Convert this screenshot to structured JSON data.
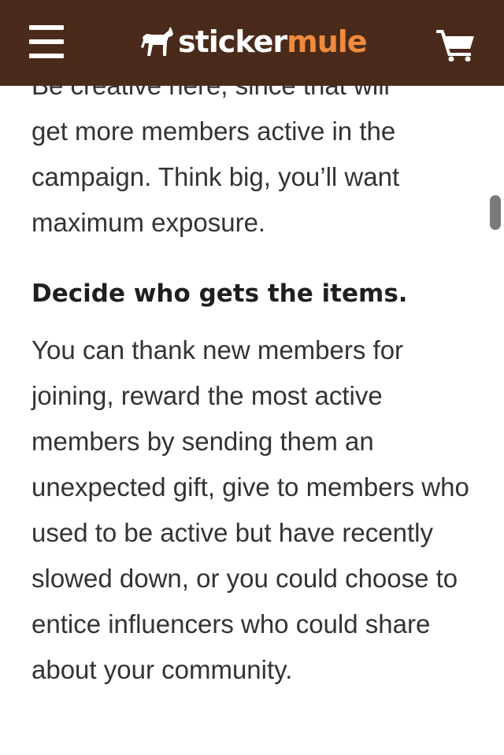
{
  "header": {
    "logo_primary": "sticker",
    "logo_accent": "mule",
    "background_color": "#4a2a1a",
    "accent_color": "#f08a3c",
    "menu_icon": "hamburger-menu-icon",
    "cart_icon": "shopping-cart-icon",
    "logo_icon": "mule-icon"
  },
  "article": {
    "intro_cut_line": "Be creative here, since that will",
    "intro_continuation": "get more members active in the campaign. Think big, you’ll want maximum exposure.",
    "heading": "Decide who gets the items.",
    "body": "You can thank new members for joining, reward the most active members by sending them an unexpected gift, give to members who used to be active but have recently slowed down, or you could choose to entice influencers who could share about your community."
  }
}
